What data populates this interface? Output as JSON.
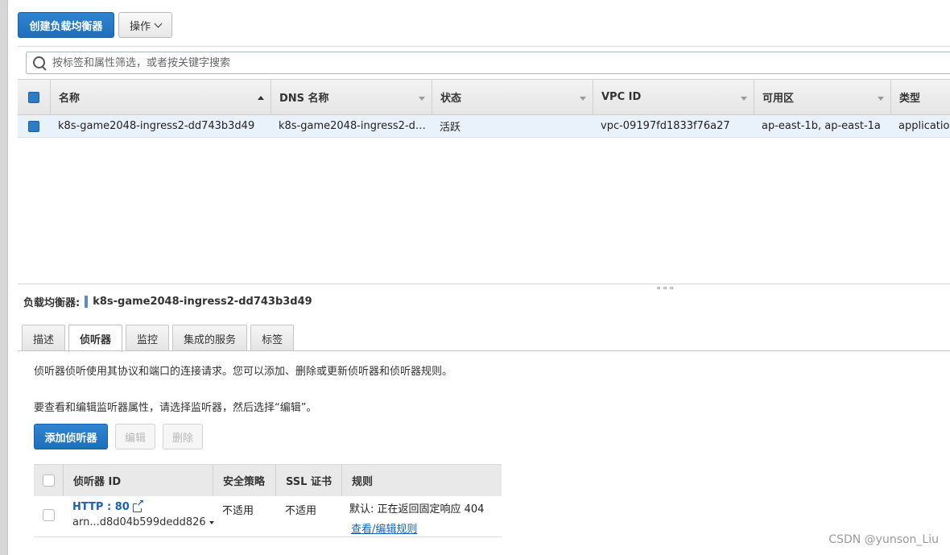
{
  "toolbar": {
    "create_button": "创建负载均衡器",
    "actions_button": "操作"
  },
  "search": {
    "placeholder": "按标签和属性筛选，或者按关键字搜索"
  },
  "lb_table": {
    "columns": [
      "名称",
      "DNS 名称",
      "状态",
      "VPC ID",
      "可用区",
      "类型"
    ],
    "rows": [
      {
        "name": "k8s-game2048-ingress2-dd743b3d49",
        "dns": "k8s-game2048-ingress2-dd7…",
        "state": "活跃",
        "vpc": "vpc-09197fd1833f76a27",
        "az": "ap-east-1b, ap-east-1a",
        "type": "application"
      }
    ]
  },
  "details": {
    "label": "负载均衡器:",
    "lb_name": "k8s-game2048-ingress2-dd743b3d49",
    "tabs": [
      "描述",
      "侦听器",
      "监控",
      "集成的服务",
      "标签"
    ],
    "active_tab": "侦听器",
    "desc1": "侦听器侦听使用其协议和端口的连接请求。您可以添加、删除或更新侦听器和侦听器规则。",
    "desc2": "要查看和编辑监听器属性，请选择监听器，然后选择“编辑”。",
    "add_button": "添加侦听器",
    "edit_button": "编辑",
    "delete_button": "删除"
  },
  "listener_table": {
    "columns": [
      "侦听器 ID",
      "安全策略",
      "SSL 证书",
      "规则"
    ],
    "rows": [
      {
        "id": "HTTP : 80",
        "arn": "arn...d8d04b599dedd826",
        "policy": "不适用",
        "ssl": "不适用",
        "rule": "默认:  正在返回固定响应 404",
        "rule_link": "查看/编辑规则"
      }
    ]
  },
  "watermark": "CSDN @yunson_Liu",
  "colors": {
    "primary": "#2577c4",
    "link": "#1b63b0",
    "selected_row": "#e9f1fb"
  }
}
